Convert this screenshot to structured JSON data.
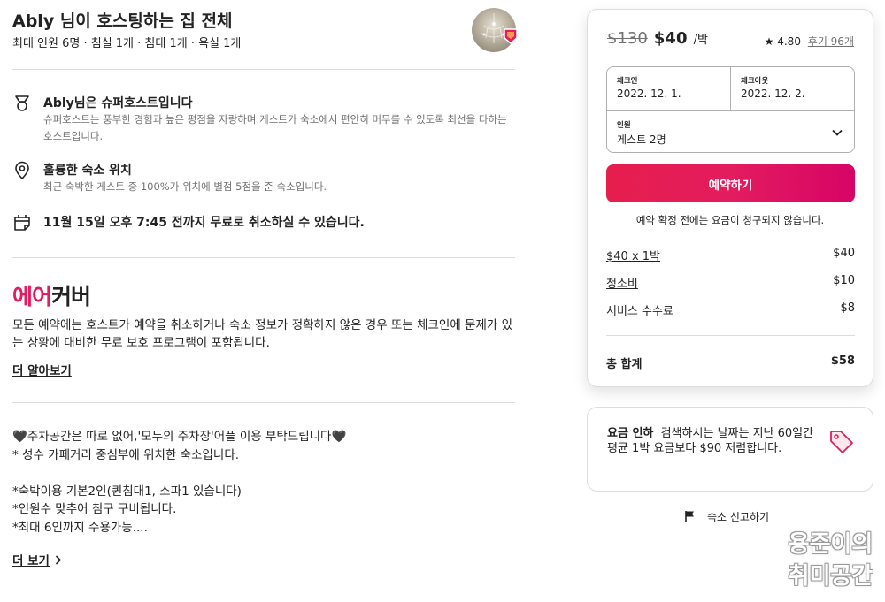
{
  "listing": {
    "title": "Ably 님이 호스팅하는 집 전체",
    "subtitle": "최대 인원 6명 · 침실 1개 · 침대 1개 · 욕실 1개"
  },
  "features": [
    {
      "icon": "superhost-medal-icon",
      "title": "Ably님은 슈퍼호스트입니다",
      "desc": "슈퍼호스트는 풍부한 경험과 높은 평점을 자랑하며 게스트가 숙소에서 편안히 머무를 수 있도록 최선을 다하는 호스트입니다."
    },
    {
      "icon": "location-pin-icon",
      "title": "훌륭한 숙소 위치",
      "desc": "최근 숙박한 게스트 중 100%가 위치에 별점 5점을 준 숙소입니다."
    },
    {
      "icon": "calendar-icon",
      "title": "11월 15일 오후 7:45 전까지 무료로 취소하실 수 있습니다.",
      "desc": ""
    }
  ],
  "aircover": {
    "logo_red": "에어",
    "logo_black": "커버",
    "description": "모든 예약에는 호스트가 예약을 취소하거나 숙소 정보가 정확하지 않은 경우 또는 체크인에 문제가 있는 상황에 대비한 무료 보호 프로그램이 포함됩니다.",
    "learn_more": "더 알아보기"
  },
  "description": {
    "lines": [
      "🖤주차공간은 따로 없어,'모두의 주차장'어플 이용 부탁드립니다🖤",
      "* 성수 카페거리 중심부에 위치한 숙소입니다.",
      "",
      "*숙박이용 기본2인(퀸침대1, 소파1 있습니다)",
      "*인원수 맞추어 침구 구비됩니다.",
      "*최대 6인까지 수용가능...."
    ],
    "show_more": "더 보기"
  },
  "booking": {
    "price_original": "$130",
    "price_now": "$40",
    "price_unit": "/박",
    "rating": "4.80",
    "reviews": "후기 96개",
    "checkin_label": "체크인",
    "checkin_value": "2022. 12. 1.",
    "checkout_label": "체크아웃",
    "checkout_value": "2022. 12. 2.",
    "guests_label": "인원",
    "guests_value": "게스트 2명",
    "reserve_button": "예약하기",
    "no_charge_note": "예약 확정 전에는 요금이 청구되지 않습니다.",
    "fees": [
      {
        "label": "$40 x 1박",
        "amount": "$40"
      },
      {
        "label": "청소비",
        "amount": "$10"
      },
      {
        "label": "서비스 수수료",
        "amount": "$8"
      }
    ],
    "total_label": "총 합계",
    "total_amount": "$58"
  },
  "rare_find": {
    "title": "요금 인하",
    "text": "검색하시는 날짜는 지난 60일간 평균 1박 요금보다 $90 저렴합니다.",
    "icon": "price-tag-icon"
  },
  "report": {
    "label": "숙소 신고하기",
    "icon": "flag-icon"
  },
  "watermark": {
    "line1": "용준이의",
    "line2": "취미공간"
  },
  "colors": {
    "brand": "#e31c5f",
    "text": "#222222",
    "muted": "#717171",
    "border": "#dddddd"
  }
}
